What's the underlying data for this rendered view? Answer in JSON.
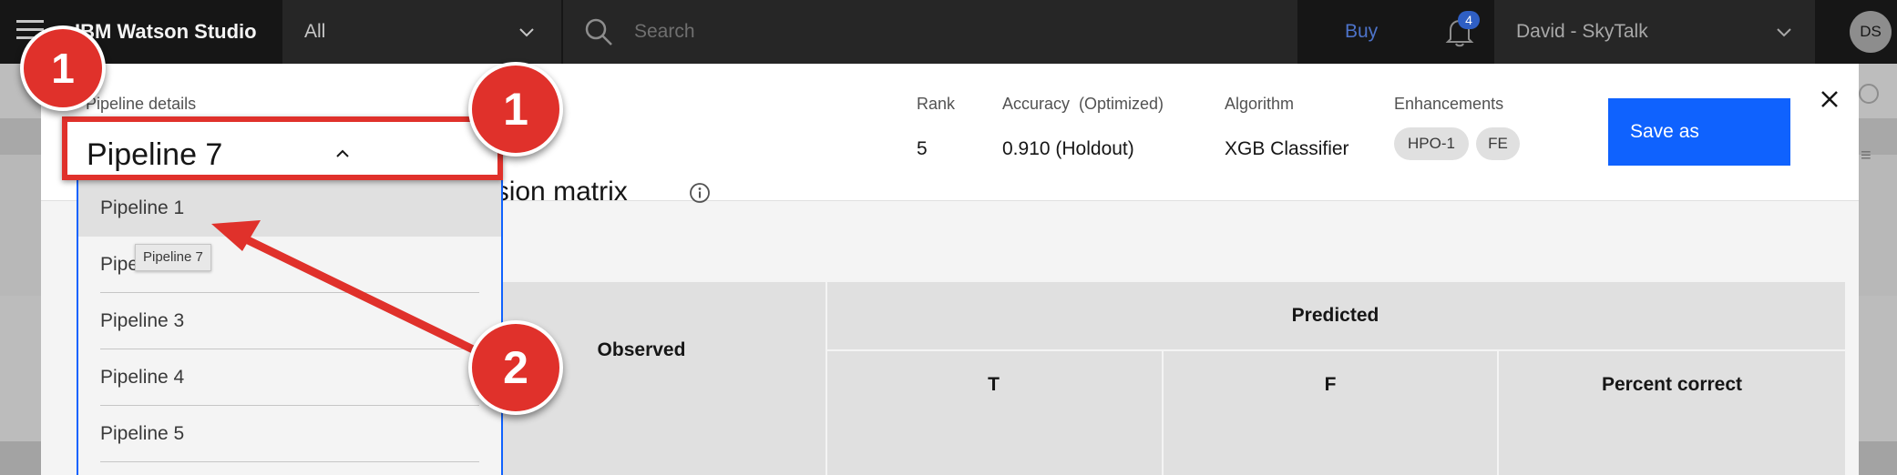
{
  "topbar": {
    "brand": "IBM Watson Studio",
    "scope_label": "All",
    "search_placeholder": "Search",
    "buy_label": "Buy",
    "notification_count": "4",
    "account_label": "David - SkyTalk",
    "avatar_initials": "DS"
  },
  "modal": {
    "pipeline_details_label": "Pipeline details",
    "selected_pipeline": "Pipeline 7",
    "rank_label": "Rank",
    "rank_value": "5",
    "accuracy_label": "Accuracy  (Optimized)",
    "accuracy_value": "0.910 (Holdout)",
    "algorithm_label": "Algorithm",
    "algorithm_value": "XGB Classifier",
    "enhancements_label": "Enhancements",
    "enhancements": [
      "HPO-1",
      "FE"
    ],
    "save_as_label": "Save as"
  },
  "dropdown": {
    "items": [
      "Pipeline 1",
      "Pipeline 2",
      "Pipeline 3",
      "Pipeline 4",
      "Pipeline 5"
    ],
    "tooltip": "Pipeline 7"
  },
  "confusion_matrix": {
    "title_fragment": "nfusion matrix",
    "observed_header": "Observed",
    "predicted_header": "Predicted",
    "columns": [
      "T",
      "F",
      "Percent correct"
    ]
  },
  "annotations": {
    "badge_topleft": "1",
    "badge_box": "1",
    "badge_arrow": "2"
  },
  "colors": {
    "accent": "#0f62fe",
    "annotation_red": "#e0312b",
    "topbar_bg": "#161616"
  }
}
